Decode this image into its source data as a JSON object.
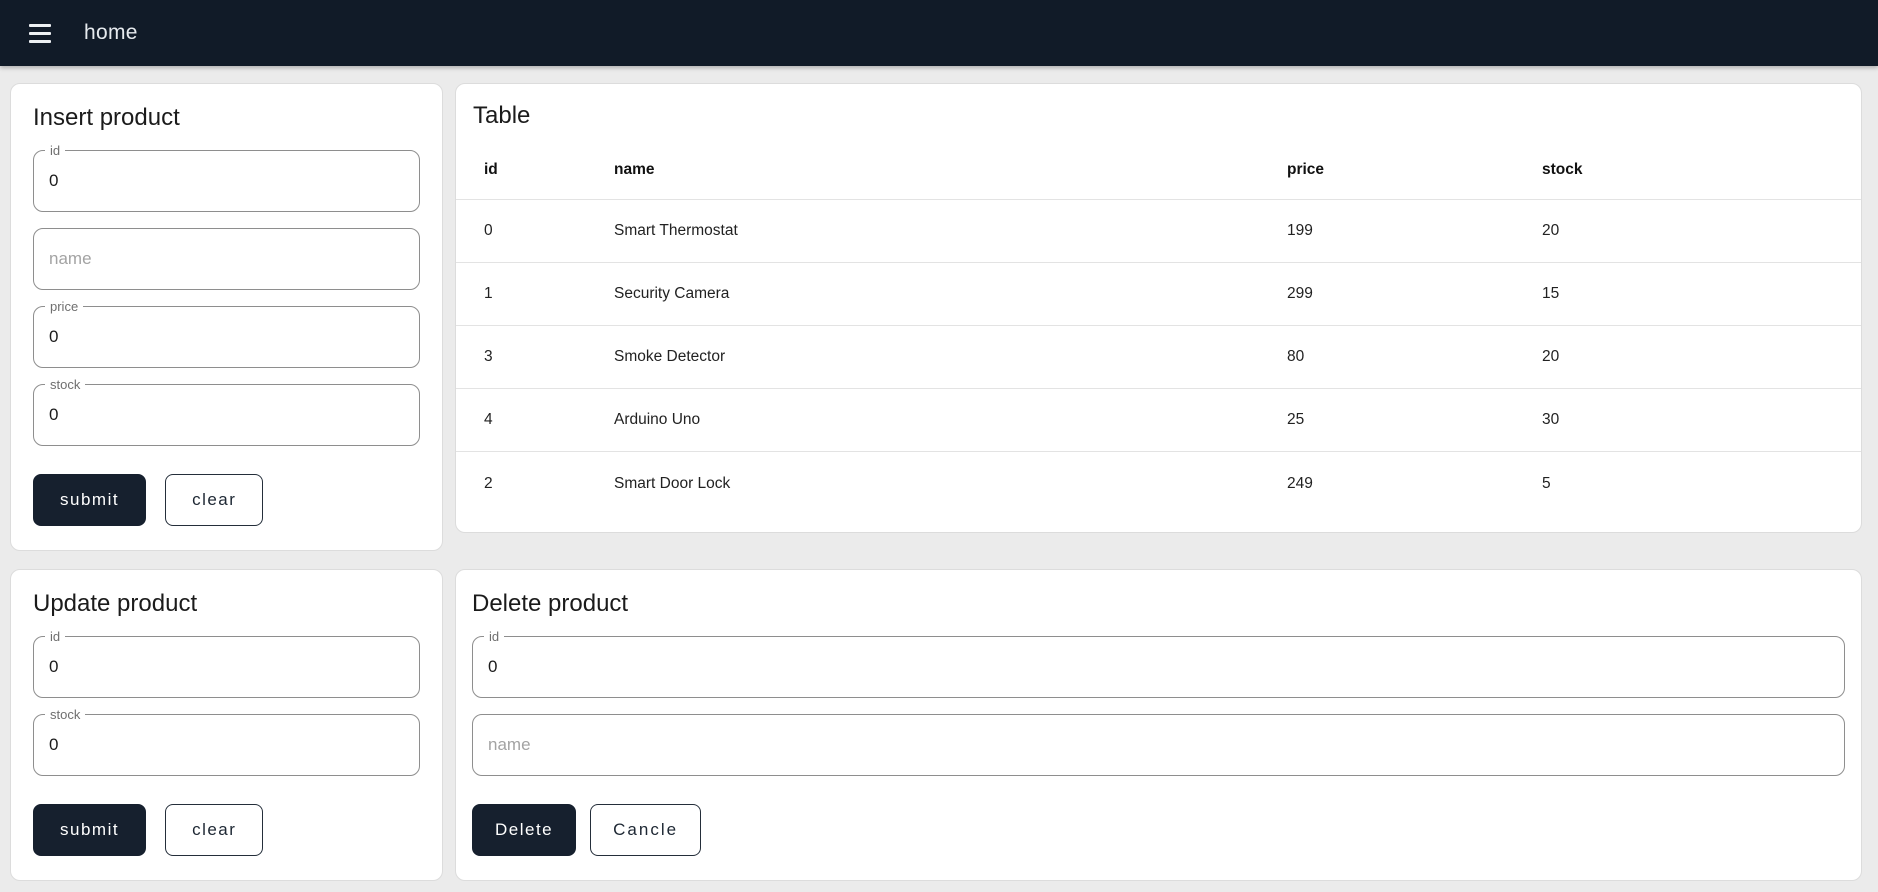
{
  "navbar": {
    "title": "home",
    "menu_icon": "hamburger-icon",
    "bg_color": "#111b28"
  },
  "colors": {
    "page_bg": "#ebebeb",
    "accent_dark": "#16202e",
    "card_border": "#dcdcdc"
  },
  "panels": {
    "insert": {
      "title": "Insert product",
      "fields": {
        "id": {
          "label": "id",
          "value": "0"
        },
        "name": {
          "placeholder": "name",
          "value": ""
        },
        "price": {
          "label": "price",
          "value": "0"
        },
        "stock": {
          "label": "stock",
          "value": "0"
        }
      },
      "buttons": {
        "submit": "submit",
        "clear": "clear"
      }
    },
    "table": {
      "title": "Table",
      "columns": {
        "id": "id",
        "name": "name",
        "price": "price",
        "stock": "stock"
      },
      "rows": [
        {
          "id": "0",
          "name": "Smart Thermostat",
          "price": "199",
          "stock": "20"
        },
        {
          "id": "1",
          "name": "Security Camera",
          "price": "299",
          "stock": "15"
        },
        {
          "id": "3",
          "name": "Smoke Detector",
          "price": "80",
          "stock": "20"
        },
        {
          "id": "4",
          "name": "Arduino Uno",
          "price": "25",
          "stock": "30"
        },
        {
          "id": "2",
          "name": "Smart Door Lock",
          "price": "249",
          "stock": "5"
        }
      ]
    },
    "update": {
      "title": "Update product",
      "fields": {
        "id": {
          "label": "id",
          "value": "0"
        },
        "stock": {
          "label": "stock",
          "value": "0"
        }
      },
      "buttons": {
        "submit": "submit",
        "clear": "clear"
      }
    },
    "delete": {
      "title": "Delete product",
      "fields": {
        "id": {
          "label": "id",
          "value": "0"
        },
        "name": {
          "placeholder": "name",
          "value": ""
        }
      },
      "buttons": {
        "delete": "Delete",
        "cancel": "Cancle"
      }
    }
  }
}
